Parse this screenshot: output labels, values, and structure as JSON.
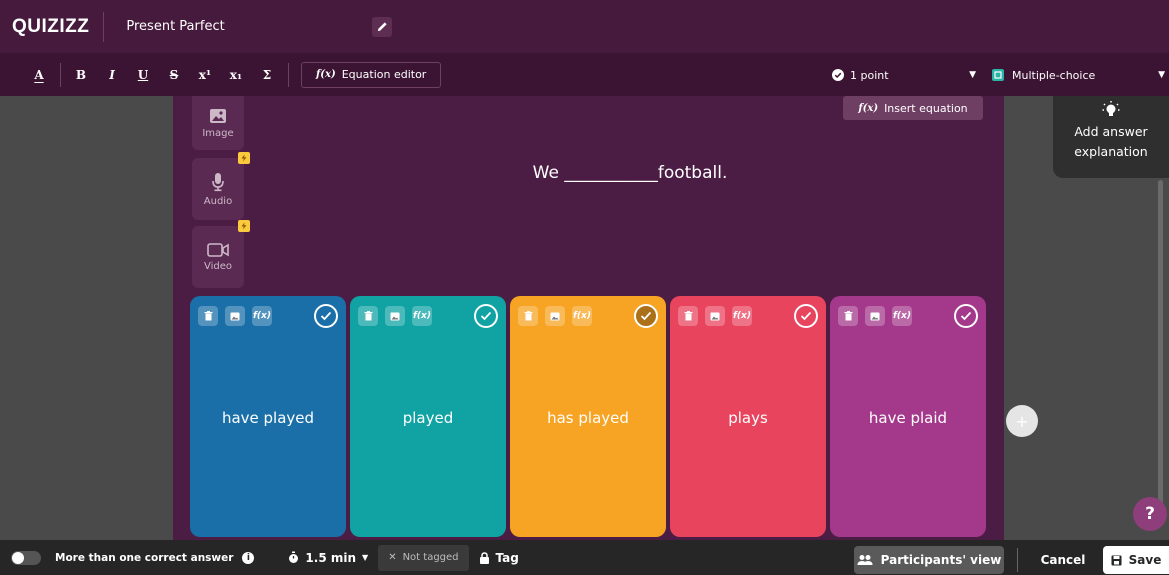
{
  "header": {
    "logo": "QUIZIZZ",
    "quiz_title": "Present Parfect"
  },
  "toolbar": {
    "format_buttons": [
      "A",
      "B",
      "I",
      "U",
      "S",
      "x¹",
      "x₁",
      "Σ"
    ],
    "equation_editor_label": "Equation editor",
    "eq_icon": "f(x)",
    "points_label": "1 point",
    "question_type_label": "Multiple-choice"
  },
  "media": {
    "image_label": "Image",
    "audio_label": "Audio",
    "video_label": "Video"
  },
  "question": {
    "insert_equation_label": "Insert equation",
    "text": "We ___________football."
  },
  "options": [
    {
      "text": "have played",
      "color": "#1a6fa8"
    },
    {
      "text": "played",
      "color": "#11a3a3"
    },
    {
      "text": "has played",
      "color": "#f7a323"
    },
    {
      "text": "plays",
      "color": "#e8445e"
    },
    {
      "text": "have plaid",
      "color": "#a4388b"
    }
  ],
  "explanation": {
    "label": "Add answer explanation"
  },
  "add_option_label": "+",
  "help_label": "?",
  "bottombar": {
    "multi_answer_label": "More than one correct answer",
    "info_label": "i",
    "time_label": "1.5 min",
    "not_tagged_label": "Not tagged",
    "tag_label": "Tag",
    "participants_view_label": "Participants' view",
    "cancel_label": "Cancel",
    "save_label": "Save"
  }
}
